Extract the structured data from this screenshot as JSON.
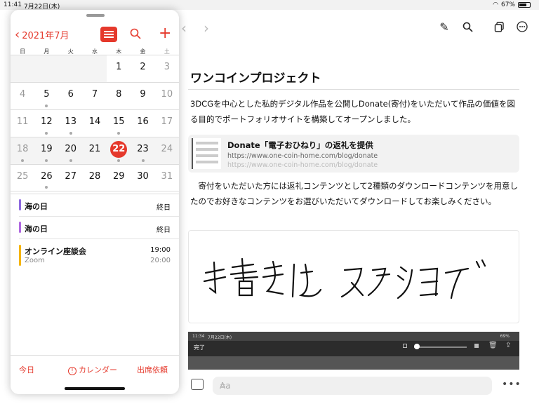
{
  "status": {
    "time": "11:41",
    "date": "7月22日(木)",
    "battery": "67%"
  },
  "notes": {
    "title": "ワンコインプロジェクト",
    "para1": "3DCGを中心とした私的デジタル作品を公開しDonate(寄付)をいただいて作品の価値を図る目的でポートフォリオサイトを構築してオープンしました。",
    "link": {
      "title": "Donate「電子おひねり」の返礼を提供",
      "url": "https://www.one-coin-home.com/blog/donate",
      "url2": "https://www.one-coin-home.com/blog/donate"
    },
    "para2": "　寄付をいただいた方には返礼コンテンツとして2種類のダウンロードコンテンツを用意したのでお好きなコンテンツをお選びいただいてダウンロードしてお楽しみください。",
    "handwriting": "手書きはスクショで",
    "embed": {
      "time": "11:34",
      "date": "7月22日(木)",
      "battery": "69%",
      "done": "完了"
    },
    "input_placeholder": "Aa"
  },
  "calendar": {
    "month_label": "2021年7月",
    "weekdays": [
      "日",
      "月",
      "火",
      "水",
      "木",
      "金",
      "土"
    ],
    "weeks": [
      [
        "",
        "",
        "",
        "",
        "1",
        "2",
        "3"
      ],
      [
        "4",
        "5",
        "6",
        "7",
        "8",
        "9",
        "10"
      ],
      [
        "11",
        "12",
        "13",
        "14",
        "15",
        "16",
        "17"
      ],
      [
        "18",
        "19",
        "20",
        "21",
        "22",
        "23",
        "24"
      ],
      [
        "25",
        "26",
        "27",
        "28",
        "29",
        "30",
        "31"
      ]
    ],
    "today": "22",
    "events": [
      {
        "name": "海の日",
        "time": "終日",
        "color": "#8e6adf"
      },
      {
        "name": "海の日",
        "time": "終日",
        "color": "#b069e0"
      },
      {
        "name": "オンライン座談会",
        "location": "Zoom",
        "start": "19:00",
        "end": "20:00",
        "color": "#f5b400"
      }
    ],
    "bottom": {
      "today": "今日",
      "calendars": "カレンダー",
      "invites": "出席依頼"
    }
  }
}
